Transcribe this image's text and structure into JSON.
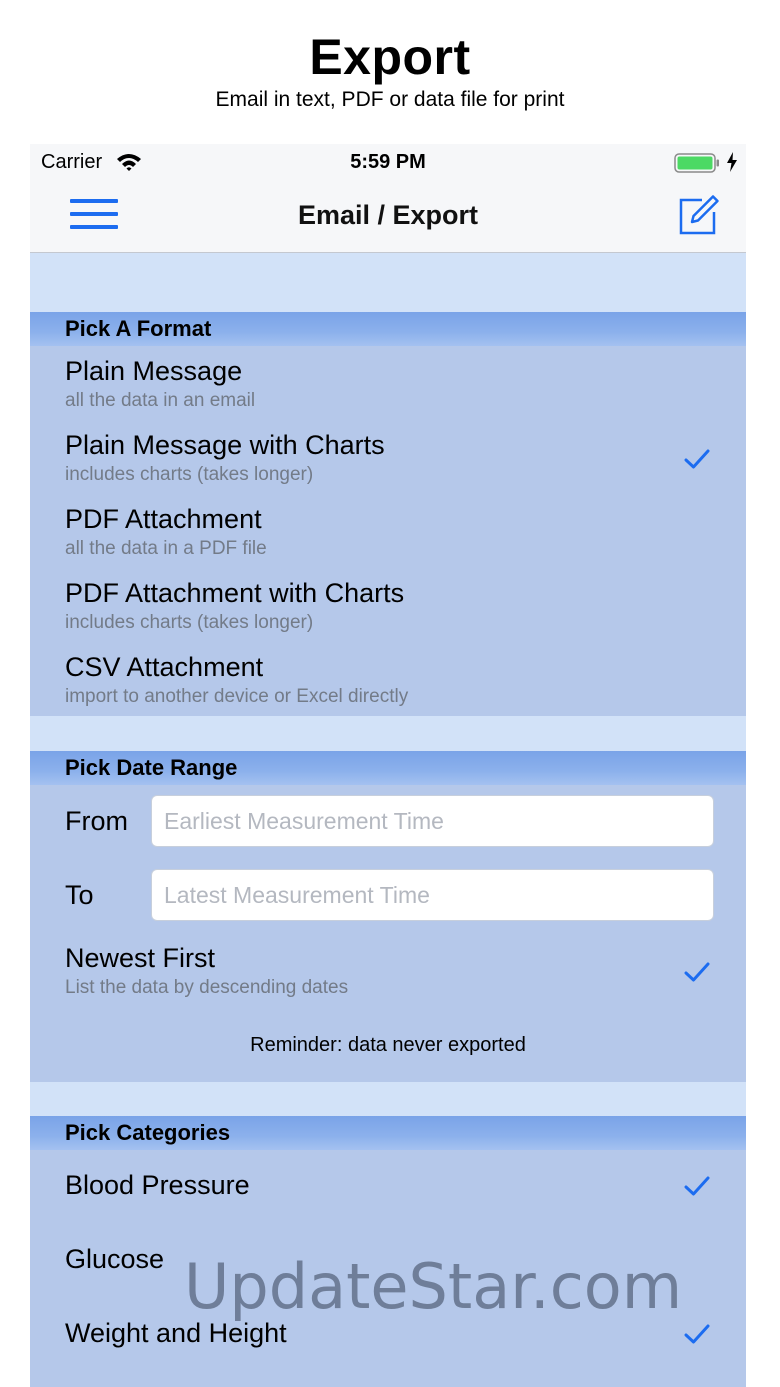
{
  "promo": {
    "title": "Export",
    "subtitle": "Email in text, PDF or data file for print"
  },
  "status_bar": {
    "carrier": "Carrier",
    "time": "5:59 PM",
    "battery_color": "#4cd964"
  },
  "nav": {
    "title": "Email / Export"
  },
  "format_section": {
    "header": "Pick A Format",
    "options": [
      {
        "title": "Plain Message",
        "subtitle": "all the data in an email",
        "checked": false
      },
      {
        "title": "Plain Message with Charts",
        "subtitle": "includes charts (takes longer)",
        "checked": true
      },
      {
        "title": "PDF Attachment",
        "subtitle": "all the data in a PDF file",
        "checked": false
      },
      {
        "title": "PDF Attachment with Charts",
        "subtitle": "includes charts (takes longer)",
        "checked": false
      },
      {
        "title": "CSV Attachment",
        "subtitle": "import to another device or Excel directly",
        "checked": false
      }
    ]
  },
  "date_section": {
    "header": "Pick Date Range",
    "from_label": "From",
    "from_placeholder": "Earliest Measurement Time",
    "from_value": "",
    "to_label": "To",
    "to_placeholder": "Latest Measurement Time",
    "to_value": "",
    "newest_title": "Newest First",
    "newest_subtitle": "List the data by descending dates",
    "newest_checked": true,
    "reminder": "Reminder: data never exported"
  },
  "categories_section": {
    "header": "Pick Categories",
    "items": [
      {
        "title": "Blood Pressure",
        "checked": true
      },
      {
        "title": "Glucose",
        "checked": false
      },
      {
        "title": "Weight and Height",
        "checked": true
      }
    ]
  },
  "watermark": "UpdateStar.com",
  "colors": {
    "accent": "#1c6cf0",
    "section_header": "#8cb1ec",
    "section_body": "#b5c8ea",
    "background": "#d2e2f8"
  }
}
